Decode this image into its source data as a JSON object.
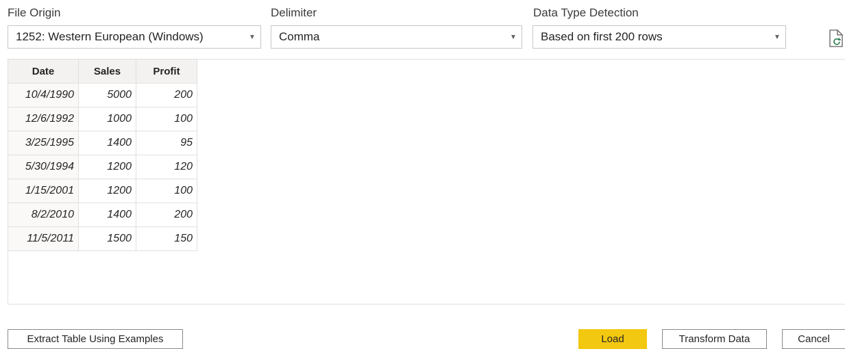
{
  "file_origin": {
    "label": "File Origin",
    "value": "1252: Western European (Windows)"
  },
  "delimiter": {
    "label": "Delimiter",
    "value": "Comma"
  },
  "data_type_detection": {
    "label": "Data Type Detection",
    "value": "Based on first 200 rows"
  },
  "icons": {
    "refresh": "refresh-file-icon",
    "dropdown": "chevron-down-icon"
  },
  "colors": {
    "load_button": "#f2c811"
  },
  "table": {
    "headers": [
      "Date",
      "Sales",
      "Profit"
    ],
    "rows": [
      [
        "10/4/1990",
        "5000",
        "200"
      ],
      [
        "12/6/1992",
        "1000",
        "100"
      ],
      [
        "3/25/1995",
        "1400",
        "95"
      ],
      [
        "5/30/1994",
        "1200",
        "120"
      ],
      [
        "1/15/2001",
        "1200",
        "100"
      ],
      [
        "8/2/2010",
        "1400",
        "200"
      ],
      [
        "11/5/2011",
        "1500",
        "150"
      ]
    ]
  },
  "buttons": {
    "extract": "Extract Table Using Examples",
    "load": "Load",
    "transform": "Transform Data",
    "cancel": "Cancel"
  }
}
